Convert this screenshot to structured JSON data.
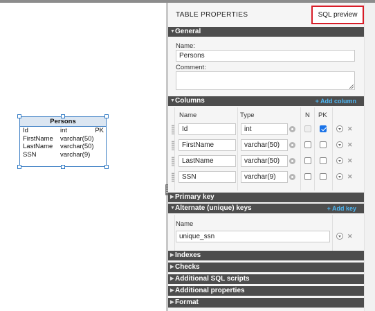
{
  "entity": {
    "name": "Persons",
    "rows": [
      {
        "name": "Id",
        "type": "int",
        "key": "PK"
      },
      {
        "name": "FirstName",
        "type": "varchar(50)",
        "key": ""
      },
      {
        "name": "LastName",
        "type": "varchar(50)",
        "key": ""
      },
      {
        "name": "SSN",
        "type": "varchar(9)",
        "key": ""
      }
    ]
  },
  "panel": {
    "title": "TABLE PROPERTIES",
    "sql_preview_label": "SQL preview"
  },
  "general": {
    "section_label": "General",
    "name_label": "Name:",
    "name_value": "Persons",
    "comment_label": "Comment:",
    "comment_value": ""
  },
  "columns": {
    "section_label": "Columns",
    "add_label": "+ Add column",
    "headers": {
      "name": "Name",
      "type": "Type",
      "n": "N",
      "pk": "PK"
    },
    "rows": [
      {
        "name": "Id",
        "type": "int",
        "nullable": false,
        "pk": true
      },
      {
        "name": "FirstName",
        "type": "varchar(50)",
        "nullable": false,
        "pk": false
      },
      {
        "name": "LastName",
        "type": "varchar(50)",
        "nullable": false,
        "pk": false
      },
      {
        "name": "SSN",
        "type": "varchar(9)",
        "nullable": false,
        "pk": false
      }
    ]
  },
  "primary_key": {
    "section_label": "Primary key"
  },
  "alternate_keys": {
    "section_label": "Alternate (unique) keys",
    "add_label": "+ Add key",
    "header_name": "Name",
    "rows": [
      {
        "name": "unique_ssn"
      }
    ]
  },
  "sections": {
    "indexes": "Indexes",
    "checks": "Checks",
    "scripts": "Additional SQL scripts",
    "properties": "Additional properties",
    "format": "Format"
  },
  "colors": {
    "section_bg": "#4d4d4d",
    "accent_link": "#4db6f2",
    "highlight_border": "#d81c27",
    "entity_border": "#3d7fc4"
  }
}
